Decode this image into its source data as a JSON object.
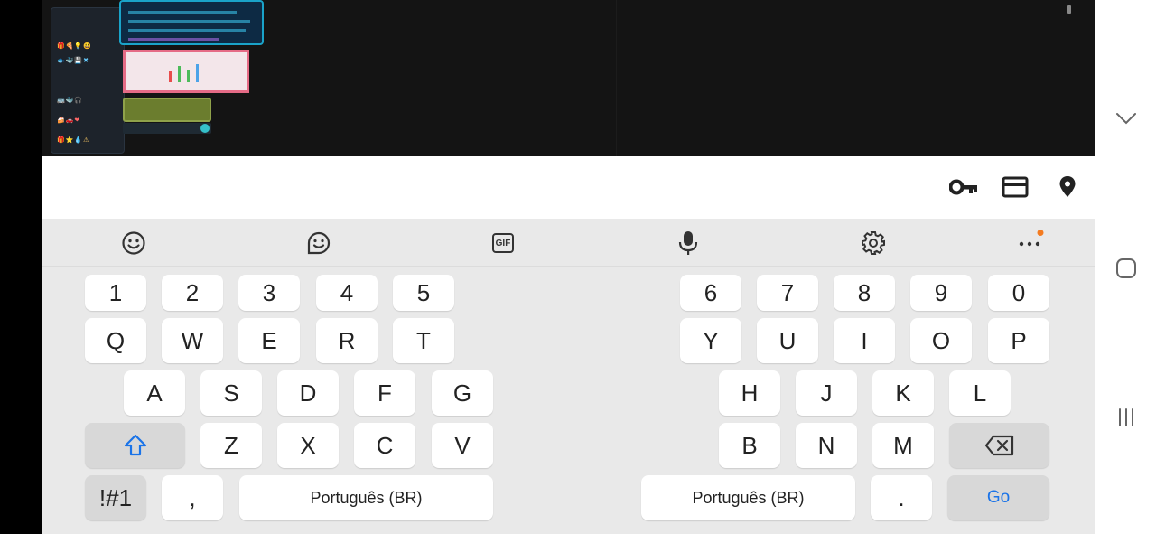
{
  "keyboard": {
    "number_row_left": [
      "1",
      "2",
      "3",
      "4",
      "5"
    ],
    "number_row_right": [
      "6",
      "7",
      "8",
      "9",
      "0"
    ],
    "row1_left": [
      "Q",
      "W",
      "E",
      "R",
      "T"
    ],
    "row1_right": [
      "Y",
      "U",
      "I",
      "O",
      "P"
    ],
    "row2_left": [
      "A",
      "S",
      "D",
      "F",
      "G"
    ],
    "row2_right": [
      "H",
      "J",
      "K",
      "L"
    ],
    "row3_left": [
      "Z",
      "X",
      "C",
      "V"
    ],
    "row3_right": [
      "B",
      "N",
      "M"
    ],
    "symbols_key": "!#1",
    "comma_key": ",",
    "period_key": ".",
    "space_left_label": "Português (BR)",
    "space_right_label": "Português (BR)",
    "go_key": "Go"
  },
  "toolbar": {
    "icons": [
      "emoji-icon",
      "sticker-icon",
      "gif-icon",
      "microphone-icon",
      "settings-icon",
      "more-icon"
    ],
    "gif_label": "GIF",
    "notification_dot_color": "#f47b20"
  },
  "autofill": {
    "icons": [
      "key-icon",
      "card-icon",
      "location-icon"
    ]
  },
  "nav": {
    "icons": [
      "chevron-down-icon",
      "home-icon",
      "recents-icon"
    ]
  },
  "colors": {
    "app_background": "#141414",
    "keyboard_background": "#e9e9e9",
    "key_background": "#ffffff",
    "function_key_background": "#d8d8d8",
    "accent": "#1a73e8"
  }
}
